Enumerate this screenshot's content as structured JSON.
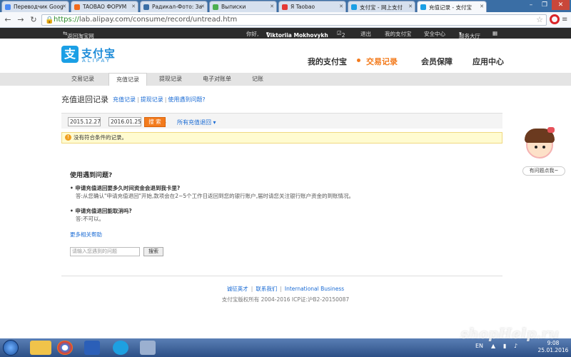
{
  "browser": {
    "tabs": [
      {
        "label": "Переводчик Goog",
        "color": "#4a8af4"
      },
      {
        "label": "TAOBAO ФОРУМ",
        "color": "#f26a1b"
      },
      {
        "label": "Радикал-Фото: За",
        "color": "#3a6ea5"
      },
      {
        "label": "Выписки",
        "color": "#4caf50"
      },
      {
        "label": "Я Taobao",
        "color": "#e53935"
      },
      {
        "label": "支付宝 - 网上支付",
        "color": "#1a9fe5"
      },
      {
        "label": "充值记录 - 支付宝",
        "color": "#1a9fe5"
      }
    ],
    "url_scheme": "https://",
    "url_rest": "lab.alipay.com/consume/record/untread.htm"
  },
  "topbar": {
    "back_link": "返回淘宝网",
    "greeting": "你好,",
    "user": "Viktoriia Mokhovykh",
    "msg_count": "2",
    "logout": "退出",
    "my_alipay": "我的支付宝",
    "security": "安全中心",
    "service": "服务大厅"
  },
  "header": {
    "logo_char": "支",
    "logo_text": "支付宝",
    "logo_sub": "ALIPAY",
    "nav": [
      "我的支付宝",
      "交易记录",
      "会员保障",
      "应用中心"
    ]
  },
  "subnav": [
    "交易记录",
    "充值记录",
    "提现记录",
    "电子对账单",
    "记账"
  ],
  "content": {
    "title": "充值退回记录",
    "links": [
      "充值记录",
      "提现记录",
      "使用遇到问题?"
    ],
    "date_from": "2015.12.27",
    "date_to": "2016.01.25",
    "search_label": "搜 索",
    "all_refunds": "所有充值退回 ▾",
    "notice": "没有符合条件的记录。",
    "help_title": "使用遇到问题?",
    "q1": "• 申请充值退回要多久时间资金会退到我卡里?",
    "a1": "答:从您确认\"申请充值退回\"开始,款项会在2~5个工作日返回到您的银行账户,届时请您关注银行账户资金的到账情况。",
    "q2": "• 申请充值退回能取消吗?",
    "a2": "答:不可以。",
    "more_help": "更多相关帮助",
    "help_placeholder": "请输入您遇到的问题",
    "help_search": "搜索"
  },
  "footer": {
    "links": [
      "诚征英才",
      "联系我们",
      "International Business"
    ],
    "copyright": "支付宝版权所有 2004-2016 ICP证:沪B2-20150087"
  },
  "helper": {
    "label": "有问题点我~"
  },
  "taskbar": {
    "lang": "EN",
    "time": "9:08",
    "date": "25.01.2016"
  },
  "watermark": "shopHelp.ru"
}
